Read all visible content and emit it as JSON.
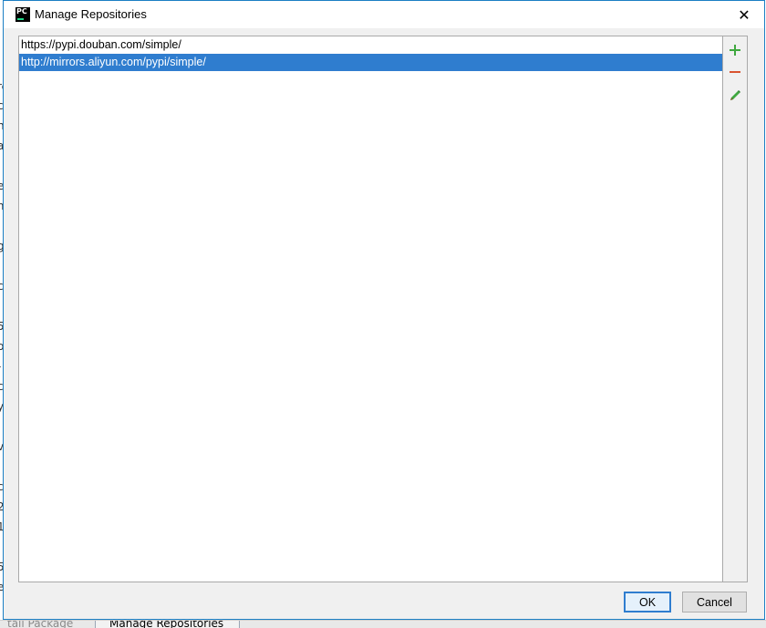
{
  "window": {
    "title": "Manage Repositories",
    "app_icon_text": "PC",
    "close_glyph": "✕"
  },
  "repositories": [
    {
      "url": "https://pypi.douban.com/simple/",
      "selected": false
    },
    {
      "url": "http://mirrors.aliyun.com/pypi/simple/",
      "selected": true
    }
  ],
  "toolbar": {
    "add_icon": "plus-icon",
    "remove_icon": "minus-icon",
    "edit_icon": "pencil-icon"
  },
  "buttons": {
    "ok_label": "OK",
    "cancel_label": "Cancel"
  },
  "background": {
    "left_fragments": [
      "re",
      "cl",
      "na",
      "a",
      "e",
      "m",
      "g'",
      "c",
      "5",
      "oc",
      "-",
      "ca",
      "y",
      "va",
      "ct",
      "2",
      "1",
      "5",
      "e"
    ],
    "bottom_tabs": [
      "tall Package",
      "Manage Repositories"
    ]
  },
  "colors": {
    "selection": "#2f7dcf",
    "add_icon": "#3fa83f",
    "remove_icon": "#d9532f",
    "edit_icon": "#3fa83f",
    "window_border": "#1b7fc4"
  }
}
